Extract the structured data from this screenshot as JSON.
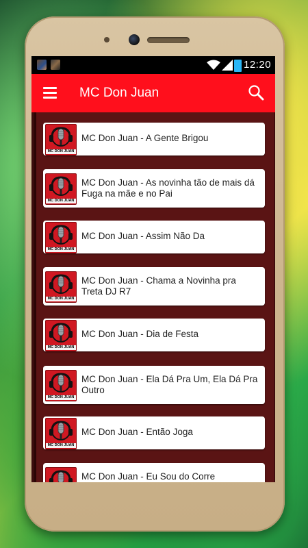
{
  "status_bar": {
    "time": "12:20",
    "icons": [
      "notification-thumbnail",
      "notification-thumbnail",
      "wifi-icon",
      "signal-icon",
      "battery-charging-icon"
    ]
  },
  "app_bar": {
    "title": "MC Don Juan",
    "menu_icon": "hamburger-menu-icon",
    "search_icon": "search-icon"
  },
  "thumbnail_label": "MC DON JUAN",
  "songs": [
    {
      "title": "MC Don Juan - A Gente Brigou"
    },
    {
      "title": "MC Don Juan - As novinha tão de mais dá Fuga na mãe e no Pai"
    },
    {
      "title": "MC Don Juan - Assim Não Da"
    },
    {
      "title": "MC Don Juan - Chama a Novinha pra Treta DJ R7"
    },
    {
      "title": "MC Don Juan - Dia de Festa"
    },
    {
      "title": "MC Don Juan - Ela Dá Pra Um, Ela Dá Pra Outro"
    },
    {
      "title": "MC Don Juan - Então Joga"
    },
    {
      "title": "MC Don Juan - Eu Sou do Corre"
    }
  ],
  "colors": {
    "app_bar": "#ff0f1c",
    "list_background": "#5a1414",
    "thumbnail": "#d01822"
  }
}
